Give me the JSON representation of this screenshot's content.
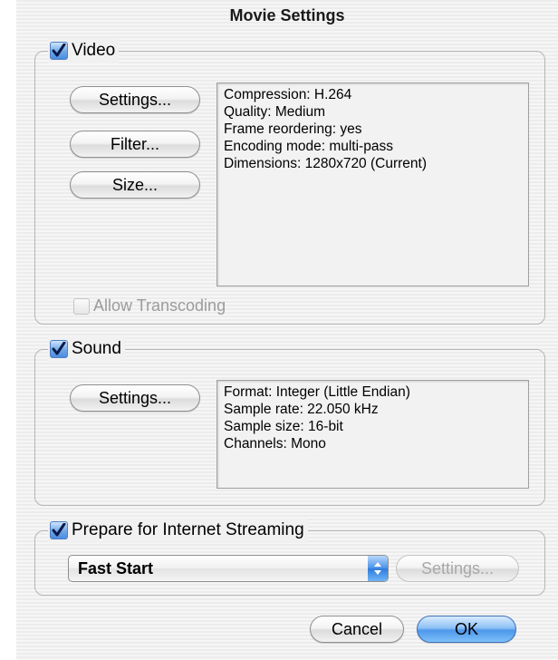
{
  "window": {
    "title": "Movie Settings"
  },
  "video": {
    "label": "Video",
    "checked": true,
    "settings_label": "Settings...",
    "filter_label": "Filter...",
    "size_label": "Size...",
    "info": [
      "Compression: H.264",
      "Quality: Medium",
      "Frame reordering: yes",
      "Encoding mode: multi-pass",
      "Dimensions: 1280x720 (Current)"
    ],
    "allow_transcoding_label": "Allow Transcoding",
    "allow_transcoding_checked": false
  },
  "sound": {
    "label": "Sound",
    "checked": true,
    "settings_label": "Settings...",
    "info": [
      "Format: Integer (Little Endian)",
      "Sample rate: 22.050 kHz",
      "Sample size: 16-bit",
      "Channels: Mono"
    ]
  },
  "streaming": {
    "label": "Prepare for Internet Streaming",
    "checked": true,
    "selected_option": "Fast Start",
    "settings_label": "Settings..."
  },
  "footer": {
    "cancel_label": "Cancel",
    "ok_label": "OK"
  },
  "colors": {
    "accent": "#4b8ce0",
    "default_button": "#4d97ec",
    "disabled_text": "#9c9c9c"
  },
  "icons": {
    "checkbox": "checkmark-icon",
    "popup": "updown-arrows-icon"
  }
}
